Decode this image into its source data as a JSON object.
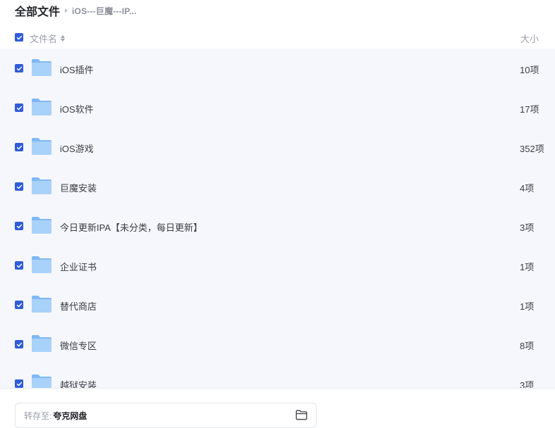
{
  "breadcrumb": {
    "root": "全部文件",
    "current": "iOS---巨魔---IP..."
  },
  "header": {
    "name_label": "文件名",
    "size_label": "大小",
    "select_all_checked": true
  },
  "files": [
    {
      "name": "iOS插件",
      "size": "10项",
      "checked": true,
      "icon": "folder-icon"
    },
    {
      "name": "iOS软件",
      "size": "17项",
      "checked": true,
      "icon": "folder-icon"
    },
    {
      "name": "iOS游戏",
      "size": "352项",
      "checked": true,
      "icon": "folder-icon"
    },
    {
      "name": "巨魔安装",
      "size": "4项",
      "checked": true,
      "icon": "folder-icon"
    },
    {
      "name": "今日更新IPA【未分类，每日更新】",
      "size": "3项",
      "checked": true,
      "icon": "folder-icon"
    },
    {
      "name": "企业证书",
      "size": "1项",
      "checked": true,
      "icon": "folder-icon"
    },
    {
      "name": "替代商店",
      "size": "1项",
      "checked": true,
      "icon": "folder-icon"
    },
    {
      "name": "微信专区",
      "size": "8项",
      "checked": true,
      "icon": "folder-icon"
    },
    {
      "name": "越狱安装",
      "size": "3项",
      "checked": true,
      "icon": "folder-icon"
    }
  ],
  "save_to": {
    "label": "转存至:",
    "target": "夸克网盘",
    "icon": "folder-outline-icon"
  },
  "colors": {
    "accent": "#2f5cd9",
    "list_background": "#f6f7fc",
    "folder_light": "#a9d2fb",
    "folder_dark": "#7fb8f5"
  }
}
